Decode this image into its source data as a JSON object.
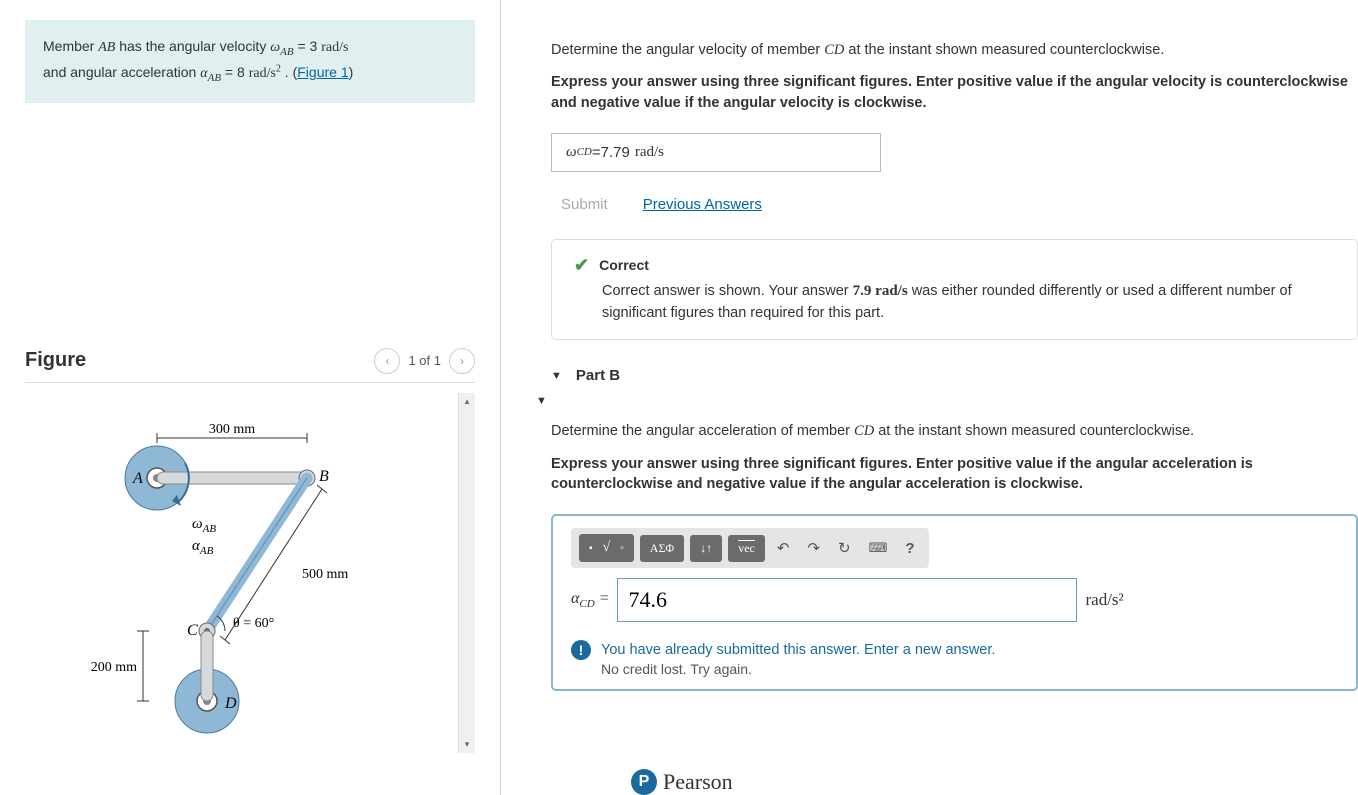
{
  "problem": {
    "member_label": "AB",
    "has_text": " has the angular velocity ",
    "omega_sym": "ω",
    "omega_sub": "AB",
    "omega_val": " = 3  ",
    "omega_units": "rad/s",
    "and_text": "and angular acceleration ",
    "alpha_sym": "α",
    "alpha_sub": "AB",
    "alpha_val": " = 8  ",
    "alpha_units_base": "rad/s",
    "alpha_units_exp": "2",
    "pre_text": "Member ",
    "dot": " . (",
    "fig_link": "Figure 1",
    "close": ")"
  },
  "figure": {
    "title": "Figure",
    "nav_text": "1 of 1",
    "dim_ab": "300 mm",
    "dim_bc": "500 mm",
    "dim_cd": "200 mm",
    "theta": "θ = 60°",
    "labelA": "A",
    "labelB": "B",
    "labelC": "C",
    "labelD": "D",
    "omega": "ω",
    "omega_sub": "AB",
    "alpha": "α",
    "alpha_sub": "AB"
  },
  "partA": {
    "question_pre": "Determine the angular velocity of member ",
    "question_member": "CD",
    "question_post": " at the instant shown measured counterclockwise.",
    "instructions": "Express your answer using three significant figures. Enter positive value if the angular velocity is counterclockwise and negative value if the angular velocity is clockwise.",
    "lhs_sym": "ω",
    "lhs_sub": "CD",
    "lhs_eq": " = ",
    "value": "7.79  ",
    "units": "rad/s",
    "submit": "Submit",
    "prev": "Previous Answers",
    "correct": "Correct",
    "fb_pre": "Correct answer is shown. Your answer ",
    "fb_val": "7.9 rad/s",
    "fb_post": " was either rounded differently or used a different number of significant figures than required for this part."
  },
  "partB": {
    "header": "Part B",
    "question_pre": "Determine the angular acceleration of member ",
    "question_member": "CD",
    "question_post": " at the instant shown measured counterclockwise.",
    "instructions": "Express your answer using three significant figures. Enter positive value if the angular acceleration is counterclockwise and negative value if the angular acceleration is clockwise.",
    "toolbar": {
      "templates": "■√□",
      "greek": "ΑΣΦ",
      "updown": "↓↑",
      "vec": "vec",
      "undo": "↶",
      "redo": "↷",
      "reset": "↻",
      "keyboard": "⌨",
      "help": "?"
    },
    "lhs_sym": "α",
    "lhs_sub": "CD",
    "lhs_eq": " = ",
    "value": "74.6",
    "units": "rad/s²",
    "warn_line1": "You have already submitted this answer. Enter a new answer.",
    "warn_line2": "No credit lost. Try again."
  },
  "footer": {
    "brand": "Pearson"
  }
}
